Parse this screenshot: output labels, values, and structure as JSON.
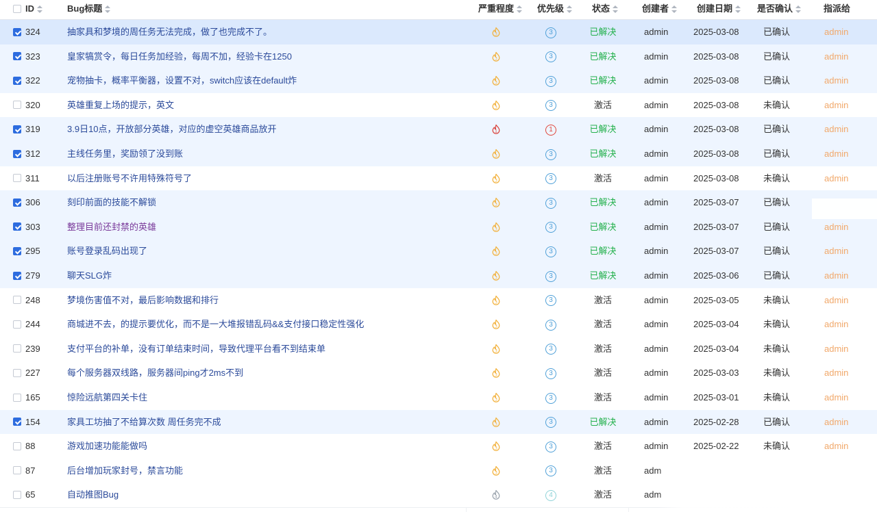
{
  "columns": {
    "id": "ID",
    "title": "Bug标题",
    "severity": "严重程度",
    "priority": "优先级",
    "status": "状态",
    "creator": "创建者",
    "created": "创建日期",
    "confirmed": "是否确认",
    "assigned": "指派给"
  },
  "colors": {
    "accent": "#2d6cdf",
    "resolved": "#22b04b",
    "assignee": "#f1a86a",
    "selected_row": "#eef5ff"
  },
  "rows": [
    {
      "id": "324",
      "title": "抽家具和梦境的周任务无法完成，做了也完成不了。",
      "severity": "3",
      "priority": "3",
      "status": "已解决",
      "creator": "admin",
      "created": "2025-03-08",
      "confirmed": "已确认",
      "assigned": "admin",
      "checked": true
    },
    {
      "id": "323",
      "title": "皇家犒赏令，每日任务加经验，每周不加，经验卡在1250",
      "severity": "3",
      "priority": "3",
      "status": "已解决",
      "creator": "admin",
      "created": "2025-03-08",
      "confirmed": "已确认",
      "assigned": "admin",
      "checked": true
    },
    {
      "id": "322",
      "title": "宠物抽卡，概率平衡器，设置不对，switch应该在default炸",
      "severity": "3",
      "priority": "3",
      "status": "已解决",
      "creator": "admin",
      "created": "2025-03-08",
      "confirmed": "已确认",
      "assigned": "admin",
      "checked": true
    },
    {
      "id": "320",
      "title": "英雄重复上场的提示，英文",
      "severity": "3",
      "priority": "3",
      "status": "激活",
      "creator": "admin",
      "created": "2025-03-08",
      "confirmed": "未确认",
      "assigned": "admin",
      "checked": false
    },
    {
      "id": "319",
      "title": "3.9日10点，开放部分英雄，对应的虚空英雄商品放开",
      "severity": "1",
      "priority": "1",
      "status": "已解决",
      "creator": "admin",
      "created": "2025-03-08",
      "confirmed": "已确认",
      "assigned": "admin",
      "checked": true
    },
    {
      "id": "312",
      "title": "主线任务里，奖励领了没到账",
      "severity": "3",
      "priority": "3",
      "status": "已解决",
      "creator": "admin",
      "created": "2025-03-08",
      "confirmed": "已确认",
      "assigned": "admin",
      "checked": true
    },
    {
      "id": "311",
      "title": "以后注册账号不许用特殊符号了",
      "severity": "3",
      "priority": "3",
      "status": "激活",
      "creator": "admin",
      "created": "2025-03-08",
      "confirmed": "未确认",
      "assigned": "admin",
      "checked": false
    },
    {
      "id": "306",
      "title": "刻印前面的技能不解锁",
      "severity": "3",
      "priority": "3",
      "status": "已解决",
      "creator": "admin",
      "created": "2025-03-07",
      "confirmed": "已确认",
      "assigned": "",
      "checked": true
    },
    {
      "id": "303",
      "title": "整理目前还封禁的英雄",
      "severity": "3",
      "priority": "3",
      "status": "已解决",
      "creator": "admin",
      "created": "2025-03-07",
      "confirmed": "已确认",
      "assigned": "admin",
      "checked": true,
      "visited": true
    },
    {
      "id": "295",
      "title": "账号登录乱码出现了",
      "severity": "3",
      "priority": "3",
      "status": "已解决",
      "creator": "admin",
      "created": "2025-03-07",
      "confirmed": "已确认",
      "assigned": "admin",
      "checked": true
    },
    {
      "id": "279",
      "title": "聊天SLG炸",
      "severity": "3",
      "priority": "3",
      "status": "已解决",
      "creator": "admin",
      "created": "2025-03-06",
      "confirmed": "已确认",
      "assigned": "admin",
      "checked": true
    },
    {
      "id": "248",
      "title": "梦境伤害值不对，最后影响数据和排行",
      "severity": "3",
      "priority": "3",
      "status": "激活",
      "creator": "admin",
      "created": "2025-03-05",
      "confirmed": "未确认",
      "assigned": "admin",
      "checked": false
    },
    {
      "id": "244",
      "title": "商城进不去，的提示要优化，而不是一大堆报错乱码&&支付接口稳定性强化",
      "severity": "3",
      "priority": "3",
      "status": "激活",
      "creator": "admin",
      "created": "2025-03-04",
      "confirmed": "未确认",
      "assigned": "admin",
      "checked": false
    },
    {
      "id": "239",
      "title": "支付平台的补单，没有订单结束时间，导致代理平台看不到结束单",
      "severity": "3",
      "priority": "3",
      "status": "激活",
      "creator": "admin",
      "created": "2025-03-04",
      "confirmed": "未确认",
      "assigned": "admin",
      "checked": false
    },
    {
      "id": "227",
      "title": "每个服务器双线路，服务器间ping才2ms不到",
      "severity": "3",
      "priority": "3",
      "status": "激活",
      "creator": "admin",
      "created": "2025-03-03",
      "confirmed": "未确认",
      "assigned": "admin",
      "checked": false
    },
    {
      "id": "165",
      "title": "惊险远航第四关卡住",
      "severity": "3",
      "priority": "3",
      "status": "激活",
      "creator": "admin",
      "created": "2025-03-01",
      "confirmed": "未确认",
      "assigned": "admin",
      "checked": false
    },
    {
      "id": "154",
      "title": "家具工坊抽了不给算次数 周任务完不成",
      "severity": "3",
      "priority": "3",
      "status": "已解决",
      "creator": "admin",
      "created": "2025-02-28",
      "confirmed": "已确认",
      "assigned": "admin",
      "checked": true
    },
    {
      "id": "88",
      "title": "游戏加速功能能做吗",
      "severity": "3",
      "priority": "3",
      "status": "激活",
      "creator": "admin",
      "created": "2025-02-22",
      "confirmed": "未确认",
      "assigned": "admin",
      "checked": false
    },
    {
      "id": "87",
      "title": "后台增加玩家封号，禁言功能",
      "severity": "3",
      "priority": "3",
      "status": "激活",
      "creator": "adm",
      "created": "",
      "confirmed": "",
      "assigned": "",
      "checked": false
    },
    {
      "id": "65",
      "title": "自动推图Bug",
      "severity": "4",
      "priority": "4",
      "status": "激活",
      "creator": "adm",
      "created": "",
      "confirmed": "",
      "assigned": "",
      "checked": false
    }
  ]
}
